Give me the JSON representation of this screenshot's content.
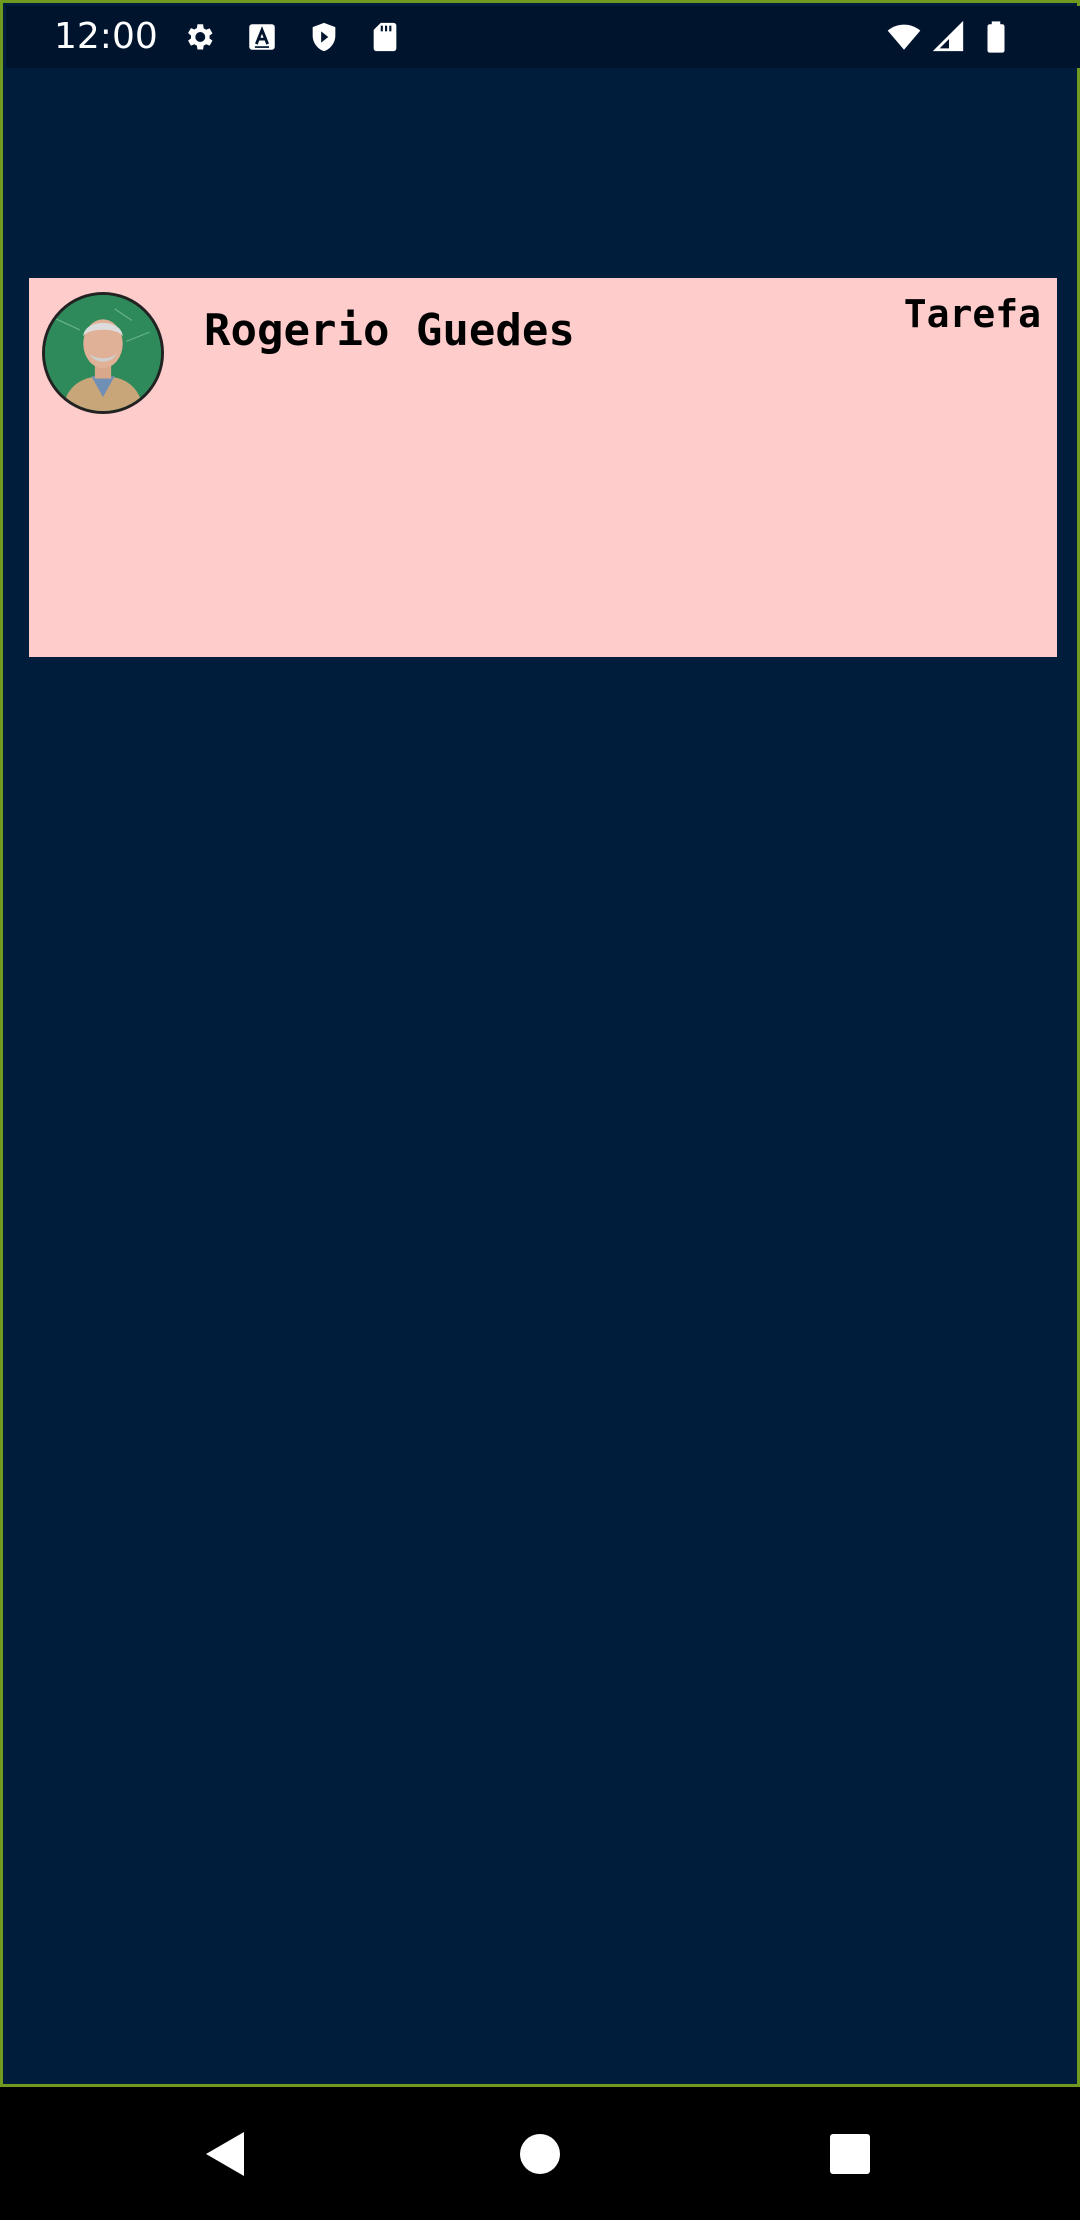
{
  "status_bar": {
    "time": "12:00",
    "left_icons": [
      "gear-icon",
      "font-a-icon",
      "shield-play-icon",
      "sd-card-icon"
    ],
    "right_icons": [
      "wifi-icon",
      "cell-signal-icon",
      "battery-icon"
    ]
  },
  "card": {
    "name": "Rogerio Guedes",
    "type_label": "Tarefa",
    "background_color": "#ffcccc"
  },
  "colors": {
    "app_background": "#001d3b",
    "frame_border": "#6f9a1f",
    "status_bar_background": "#00152d"
  },
  "nav_bar": {
    "buttons": [
      "back-icon",
      "home-icon",
      "recents-icon"
    ]
  }
}
